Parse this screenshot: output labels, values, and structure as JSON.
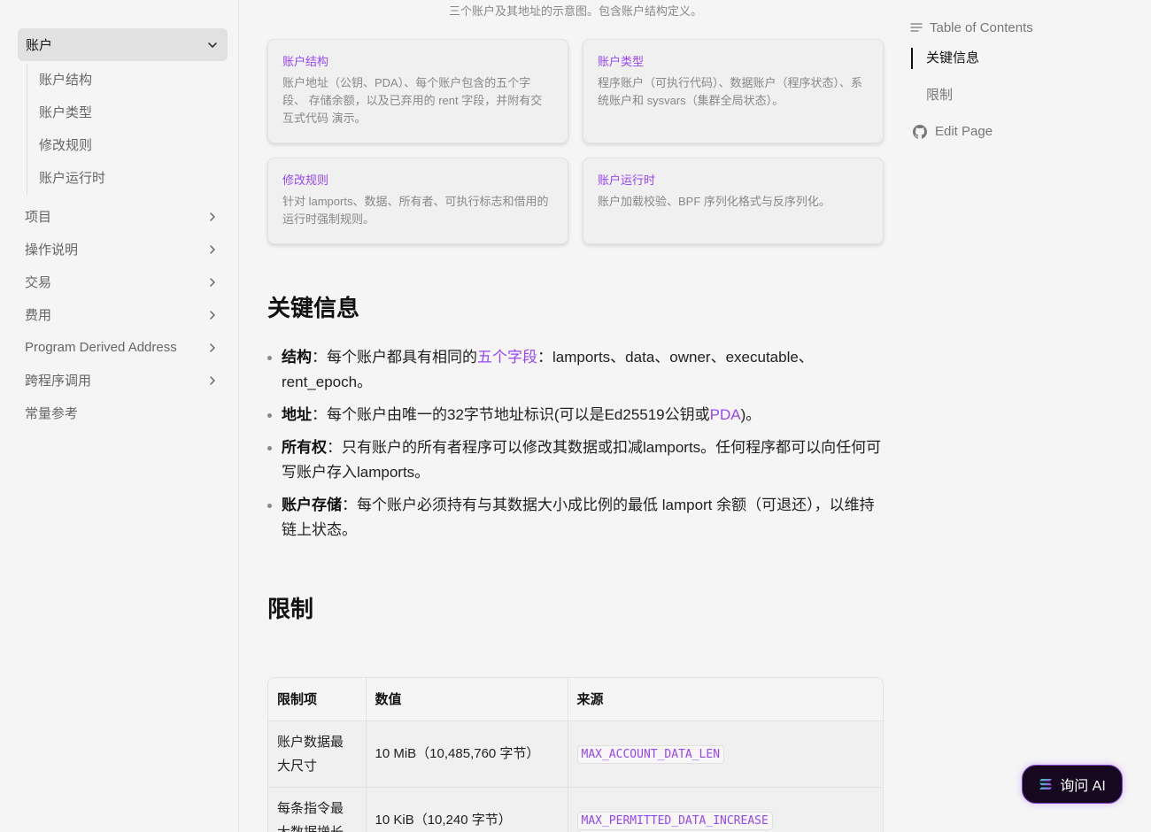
{
  "sidebar": {
    "active_section": "账户",
    "sub_items": [
      "账户结构",
      "账户类型",
      "修改规则",
      "账户运行时"
    ],
    "items": [
      "项目",
      "操作说明",
      "交易",
      "费用",
      "Program Derived Address",
      "跨程序调用",
      "常量参考"
    ]
  },
  "main": {
    "caption": "三个账户及其地址的示意图。包含账户结构定义。",
    "cards": [
      {
        "title": "账户结构",
        "desc": "账户地址（公钥、PDA）、每个账户包含的五个字段、 存储余额，以及已弃用的 rent 字段，并附有交互式代码 演示。"
      },
      {
        "title": "账户类型",
        "desc": "程序账户（可执行代码）、数据账户（程序状态）、系统账户和 sysvars（集群全局状态）。"
      },
      {
        "title": "修改规则",
        "desc": "针对 lamports、数据、所有者、可执行标志和借用的运行时强制规则。"
      },
      {
        "title": "账户运行时",
        "desc": "账户加载校验、BPF 序列化格式与反序列化。"
      }
    ],
    "key_heading": "关键信息",
    "bullets": [
      {
        "label": "结构",
        "sep": "：",
        "pre": "每个账户都具有相同的",
        "link": "五个字段",
        "post": "：lamports、data、owner、executable、rent_epoch。"
      },
      {
        "label": "地址",
        "sep": "：",
        "pre": "每个账户由唯一的32字节地址标识(可以是Ed25519公钥或",
        "link": "PDA",
        "post": ")。"
      },
      {
        "label": "所有权",
        "sep": "：",
        "pre": "只有账户的所有者程序可以修改其数据或扣减lamports。任何程序都可以向任何可写账户存入lamports。",
        "link": "",
        "post": ""
      },
      {
        "label": "账户存储",
        "sep": "：",
        "pre": "每个账户必须持有与其数据大小成比例的最低 lamport 余额（可退还），以维持链上状态。",
        "link": "",
        "post": ""
      }
    ],
    "limits_heading": "限制",
    "table": {
      "headers": [
        "限制项",
        "数值",
        "来源"
      ],
      "rows": [
        {
          "item": "账户数据最大尺寸",
          "value": "10 MiB（10,485,760 字节）",
          "source": "MAX_ACCOUNT_DATA_LEN"
        },
        {
          "item": "每条指令最大数据增长",
          "value": "10 KiB（10,240 字节）",
          "source": "MAX_PERMITTED_DATA_INCREASE"
        }
      ]
    }
  },
  "toc": {
    "heading": "Table of Contents",
    "items": [
      "关键信息",
      "限制"
    ],
    "edit_label": "Edit Page"
  },
  "ask_ai": {
    "label": "询问 AI"
  },
  "colors": {
    "accent": "#9945ff",
    "background": "#f5f5f5",
    "ask_ai_bg": "#16081f"
  }
}
